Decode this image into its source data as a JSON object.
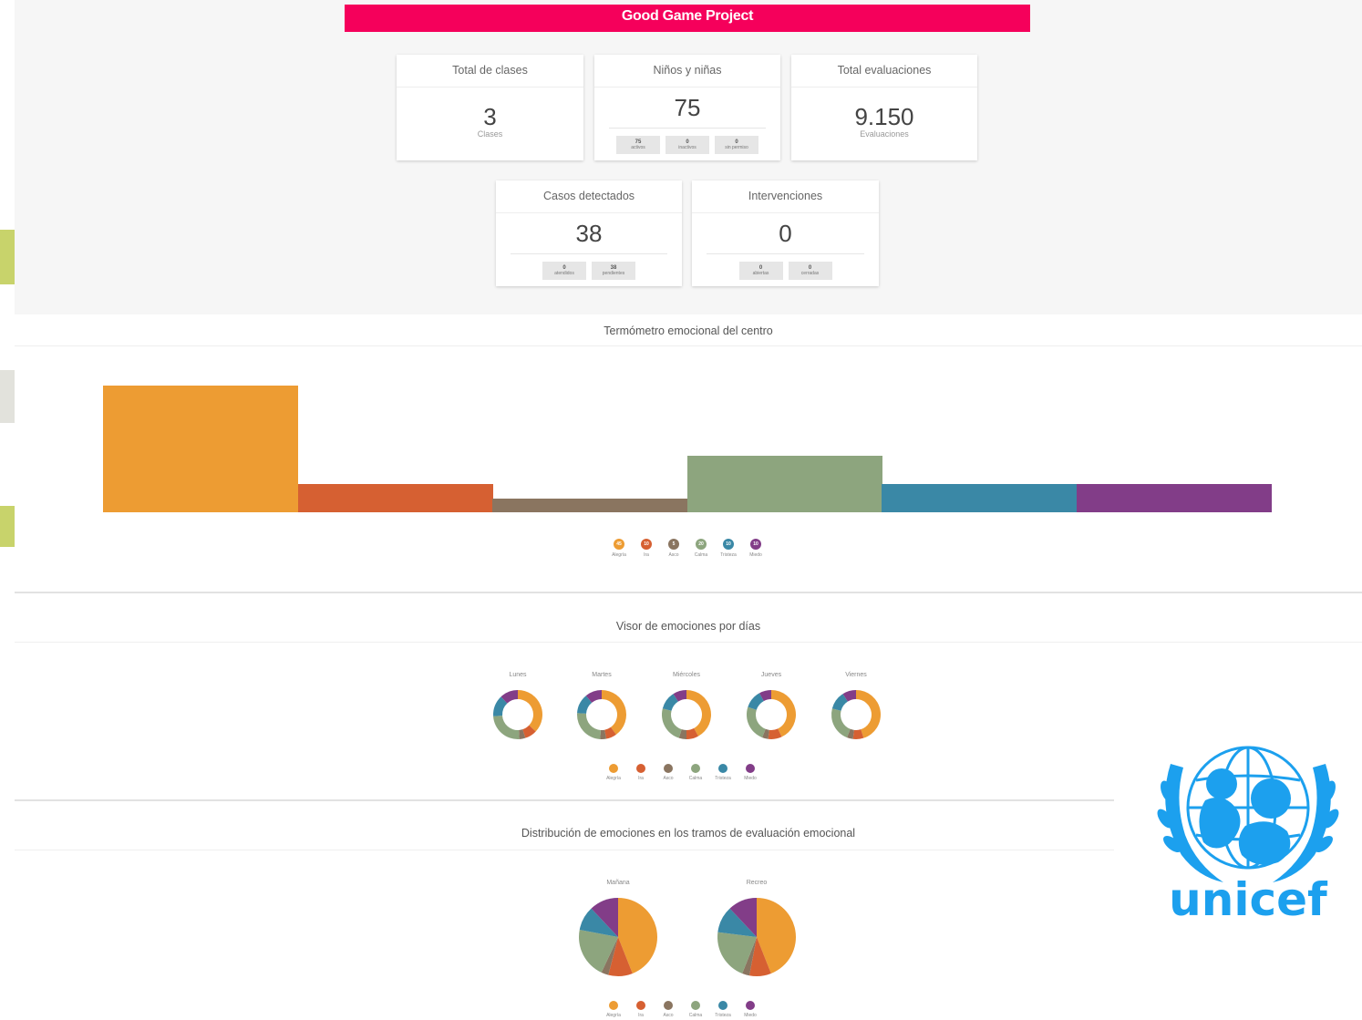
{
  "header": {
    "title": "Good Game Project"
  },
  "cards": {
    "clases": {
      "title": "Total de clases",
      "value": "3",
      "sub": "Clases"
    },
    "ninos": {
      "title": "Niños y niñas",
      "value": "75",
      "minis": [
        {
          "n": "75",
          "l": "activos"
        },
        {
          "n": "0",
          "l": "inactivos"
        },
        {
          "n": "0",
          "l": "sin permiso"
        }
      ]
    },
    "evaluaciones": {
      "title": "Total evaluaciones",
      "value": "9.150",
      "sub": "Evaluaciones"
    },
    "casos": {
      "title": "Casos detectados",
      "value": "38",
      "minis": [
        {
          "n": "0",
          "l": "atendidos"
        },
        {
          "n": "38",
          "l": "pendientes"
        }
      ]
    },
    "intervenciones": {
      "title": "Intervenciones",
      "value": "0",
      "minis": [
        {
          "n": "0",
          "l": "abiertas"
        },
        {
          "n": "0",
          "l": "cerradas"
        }
      ]
    }
  },
  "sections": {
    "termometro": "Termómetro emocional del centro",
    "visor": "Visor de emociones por días",
    "distribucion": "Distribución de emociones en los tramos de evaluación emocional"
  },
  "colors": {
    "Alegría": "#ed9c33",
    "Ira": "#d66032",
    "Asco": "#8a7560",
    "Calma": "#8da57e",
    "Tristeza": "#3a88a6",
    "Miedo": "#823d88",
    "accent": "#f5005b",
    "unicef": "#1ca0ee"
  },
  "legend_labels": [
    "Alegría",
    "Ira",
    "Asco",
    "Calma",
    "Tristeza",
    "Miedo"
  ],
  "chart_data": [
    {
      "type": "bar",
      "title": "Termómetro emocional del centro",
      "categories": [
        "Alegría",
        "Ira",
        "Asco",
        "Calma",
        "Tristeza",
        "Miedo"
      ],
      "values": [
        45,
        10,
        5,
        20,
        10,
        10
      ],
      "ylim": [
        0,
        45
      ],
      "legend": "bottom"
    },
    {
      "type": "pie",
      "title": "Visor de emociones por días",
      "categories": [
        "Alegría",
        "Ira",
        "Asco",
        "Calma",
        "Tristeza",
        "Miedo"
      ],
      "series": [
        {
          "name": "Lunes",
          "values": [
            37,
            8,
            4,
            25,
            14,
            12
          ]
        },
        {
          "name": "Martes",
          "values": [
            40,
            7,
            4,
            25,
            13,
            11
          ]
        },
        {
          "name": "Miércoles",
          "values": [
            42,
            8,
            5,
            24,
            12,
            9
          ]
        },
        {
          "name": "Jueves",
          "values": [
            43,
            9,
            4,
            24,
            12,
            8
          ]
        },
        {
          "name": "Viernes",
          "values": [
            45,
            7,
            4,
            23,
            12,
            9
          ]
        }
      ],
      "legend": "bottom"
    },
    {
      "type": "pie",
      "title": "Distribución de emociones en los tramos de evaluación emocional",
      "categories": [
        "Alegría",
        "Ira",
        "Asco",
        "Calma",
        "Tristeza",
        "Miedo"
      ],
      "series": [
        {
          "name": "Mañana",
          "values": [
            44,
            10,
            3,
            21,
            10,
            12
          ]
        },
        {
          "name": "Recreo",
          "values": [
            44,
            9,
            3,
            21,
            11,
            12
          ]
        }
      ],
      "legend": "bottom"
    }
  ],
  "logo": {
    "text": "unicef"
  }
}
